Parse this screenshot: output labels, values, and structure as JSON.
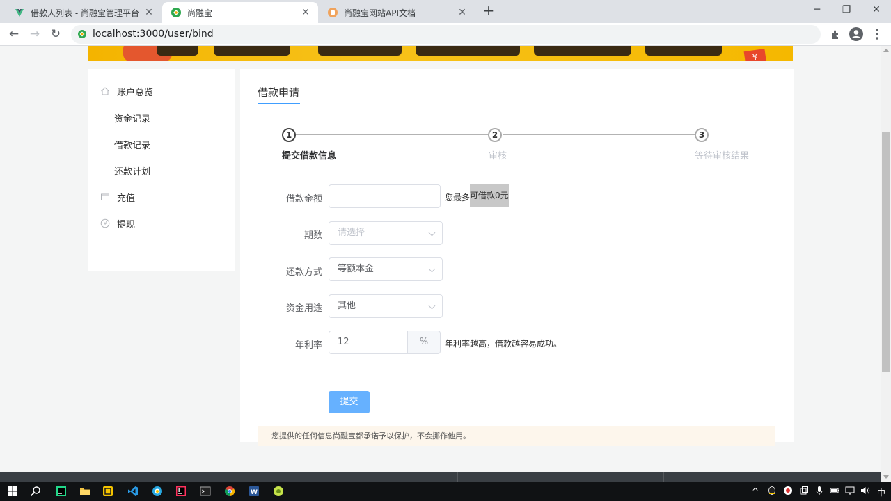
{
  "browser": {
    "tabs": [
      {
        "title": "借款人列表 - 尚融宝管理平台",
        "active": false
      },
      {
        "title": "尚融宝",
        "active": true
      },
      {
        "title": "尚融宝网站API文档",
        "active": false
      }
    ],
    "url": "localhost:3000/user/bind"
  },
  "sidebar": {
    "items": [
      {
        "label": "账户总览",
        "icon": "home-icon"
      },
      {
        "label": "资金记录"
      },
      {
        "label": "借款记录"
      },
      {
        "label": "还款计划"
      },
      {
        "label": "充值",
        "icon": "wallet-icon"
      },
      {
        "label": "提现",
        "icon": "yen-icon"
      }
    ]
  },
  "panel": {
    "title": "借款申请",
    "steps": [
      {
        "number": "1",
        "label": "提交借款信息",
        "state": "active"
      },
      {
        "number": "2",
        "label": "审核",
        "state": "wait"
      },
      {
        "number": "3",
        "label": "等待审核结果",
        "state": "wait"
      }
    ],
    "form": {
      "amount": {
        "label": "借款金额",
        "value": "",
        "hint_prefix": "您最多",
        "hint_highlight": "可借款0元"
      },
      "period": {
        "label": "期数",
        "placeholder": "请选择"
      },
      "return_method": {
        "label": "还款方式",
        "value": "等额本金"
      },
      "money_use": {
        "label": "资金用途",
        "value": "其他"
      },
      "rate": {
        "label": "年利率",
        "value": "12",
        "unit": "%",
        "hint": "年利率越高，借款越容易成功。"
      }
    },
    "submit_label": "提交",
    "notice": "您提供的任何信息尚融宝都承诺予以保护，不会挪作他用。"
  },
  "taskbar": {
    "ime": "中"
  },
  "colors": {
    "primary": "#409eff",
    "submit_bg": "#66b1ff",
    "notice_bg": "#fdf6ec",
    "banner": "#f7c21a"
  }
}
